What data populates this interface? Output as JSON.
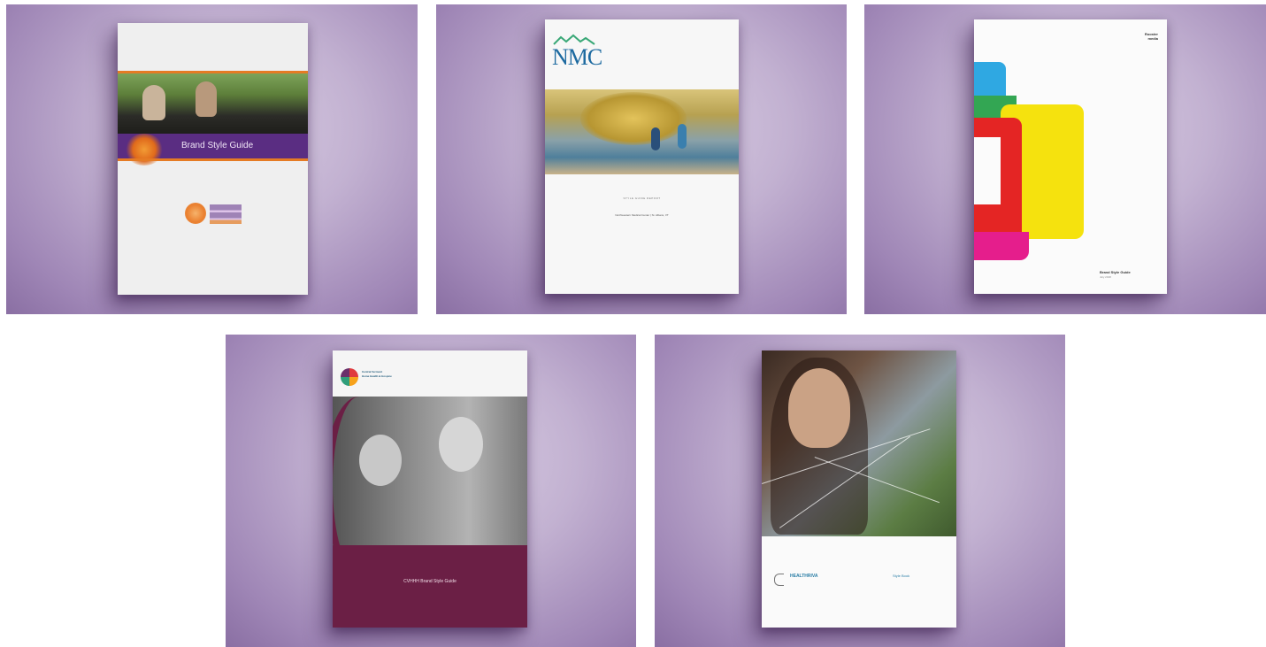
{
  "gallery": {
    "items": [
      {
        "band_text": "Brand Style Guide"
      },
      {
        "logo_text": "NMC",
        "subtitle": "STYLE GUIDE REPORT",
        "tagline": "Northwestern Medical Center  |  St. Albans, VT"
      },
      {
        "corner_logo": "Rooster\nmedia",
        "title": "Brand Style Guide",
        "date": "July 2018"
      },
      {
        "org_name": "Central Vermont\nHome Health & Hospice",
        "band_text": "CVHHH Brand Style Guide"
      },
      {
        "brand_name": "HEALTHRIVA",
        "brand_sub": "",
        "right_title": "Style Book",
        "right_sub": ""
      }
    ]
  },
  "colors": {
    "tile_background": "#c2b1d1",
    "purple_band": "#5a2d82",
    "orange_accent": "#e57b24",
    "nmc_blue": "#1d6aa0",
    "maroon_band": "#6b1f45",
    "yellow": "#f5e20e",
    "red": "#e42524",
    "blue": "#2fa8e2",
    "green": "#33a653",
    "magenta": "#e51e8c"
  }
}
